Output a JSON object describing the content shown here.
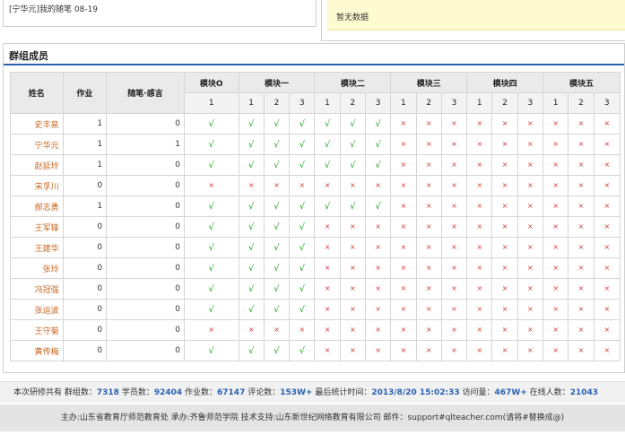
{
  "top": {
    "diary_link": "[宁华元]我的随笔 08-19",
    "no_data": "暂无数据"
  },
  "panel": {
    "title": "群组成员"
  },
  "table": {
    "headers": {
      "name": "姓名",
      "homework": "作业",
      "essay": "随笔·感言",
      "modules": [
        "模块O",
        "模块一",
        "模块二",
        "模块三",
        "模块四",
        "模块五"
      ],
      "module0_sub": [
        "1"
      ],
      "module_sub": [
        "1",
        "2",
        "3"
      ]
    },
    "rows": [
      {
        "name": "史丰泉",
        "homework": "1",
        "essay": "0",
        "marks": [
          1,
          1,
          1,
          1,
          1,
          1,
          1,
          0,
          0,
          0,
          0,
          0,
          0,
          0,
          0,
          0
        ]
      },
      {
        "name": "宁华元",
        "homework": "1",
        "essay": "1",
        "marks": [
          1,
          1,
          1,
          1,
          1,
          1,
          1,
          0,
          0,
          0,
          0,
          0,
          0,
          0,
          0,
          0
        ]
      },
      {
        "name": "赵延玲",
        "homework": "1",
        "essay": "0",
        "marks": [
          1,
          1,
          1,
          1,
          1,
          1,
          1,
          0,
          0,
          0,
          0,
          0,
          0,
          0,
          0,
          0
        ]
      },
      {
        "name": "宋孚川",
        "homework": "0",
        "essay": "0",
        "marks": [
          0,
          0,
          0,
          0,
          0,
          0,
          0,
          0,
          0,
          0,
          0,
          0,
          0,
          0,
          0,
          0
        ]
      },
      {
        "name": "郝志勇",
        "homework": "1",
        "essay": "0",
        "marks": [
          1,
          1,
          1,
          1,
          1,
          1,
          1,
          0,
          0,
          0,
          0,
          0,
          0,
          0,
          0,
          0
        ]
      },
      {
        "name": "王军锋",
        "homework": "0",
        "essay": "0",
        "marks": [
          1,
          1,
          1,
          1,
          0,
          0,
          0,
          0,
          0,
          0,
          0,
          0,
          0,
          0,
          0,
          0
        ]
      },
      {
        "name": "王建华",
        "homework": "0",
        "essay": "0",
        "marks": [
          1,
          1,
          1,
          1,
          0,
          0,
          0,
          0,
          0,
          0,
          0,
          0,
          0,
          0,
          0,
          0
        ]
      },
      {
        "name": "张玲",
        "homework": "0",
        "essay": "0",
        "marks": [
          1,
          1,
          1,
          1,
          0,
          0,
          0,
          0,
          0,
          0,
          0,
          0,
          0,
          0,
          0,
          0
        ]
      },
      {
        "name": "冯冠强",
        "homework": "0",
        "essay": "0",
        "marks": [
          1,
          1,
          1,
          1,
          0,
          0,
          0,
          0,
          0,
          0,
          0,
          0,
          0,
          0,
          0,
          0
        ]
      },
      {
        "name": "张运波",
        "homework": "0",
        "essay": "0",
        "marks": [
          1,
          1,
          1,
          1,
          0,
          0,
          0,
          0,
          0,
          0,
          0,
          0,
          0,
          0,
          0,
          0
        ]
      },
      {
        "name": "王守菊",
        "homework": "0",
        "essay": "0",
        "marks": [
          0,
          0,
          0,
          0,
          0,
          0,
          0,
          0,
          0,
          0,
          0,
          0,
          0,
          0,
          0,
          0
        ]
      },
      {
        "name": "黄传梅",
        "homework": "0",
        "essay": "0",
        "marks": [
          1,
          1,
          1,
          1,
          0,
          0,
          0,
          0,
          0,
          0,
          0,
          0,
          0,
          0,
          0,
          0
        ]
      }
    ],
    "check_glyph": "√",
    "cross_glyph": "×",
    "check_color": "#1aa01a",
    "cross_color": "#d23b3b"
  },
  "footer": {
    "stats": [
      {
        "label": "本次研修共有 群组数：",
        "value": "7318"
      },
      {
        "label": " 学员数：",
        "value": "92404"
      },
      {
        "label": " 作业数：",
        "value": "67147"
      },
      {
        "label": " 评论数：",
        "value": "153W+"
      },
      {
        "label": " 最后统计时间：",
        "value": "2013/8/20 15:02:33"
      },
      {
        "label": " 访问量：",
        "value": "467W+"
      },
      {
        "label": " 在线人数：",
        "value": "21043"
      }
    ],
    "credits": "主办:山东省教育厅师范教育处    承办:齐鲁师范学院    技术支持:山东新世纪网络教育有限公司    邮件：support#qlteacher.com(请将#替换成@)"
  },
  "colors": {
    "accent_blue": "#2a62b0",
    "name_orange": "#c8641c",
    "nodata_bg": "#fefbd0"
  }
}
